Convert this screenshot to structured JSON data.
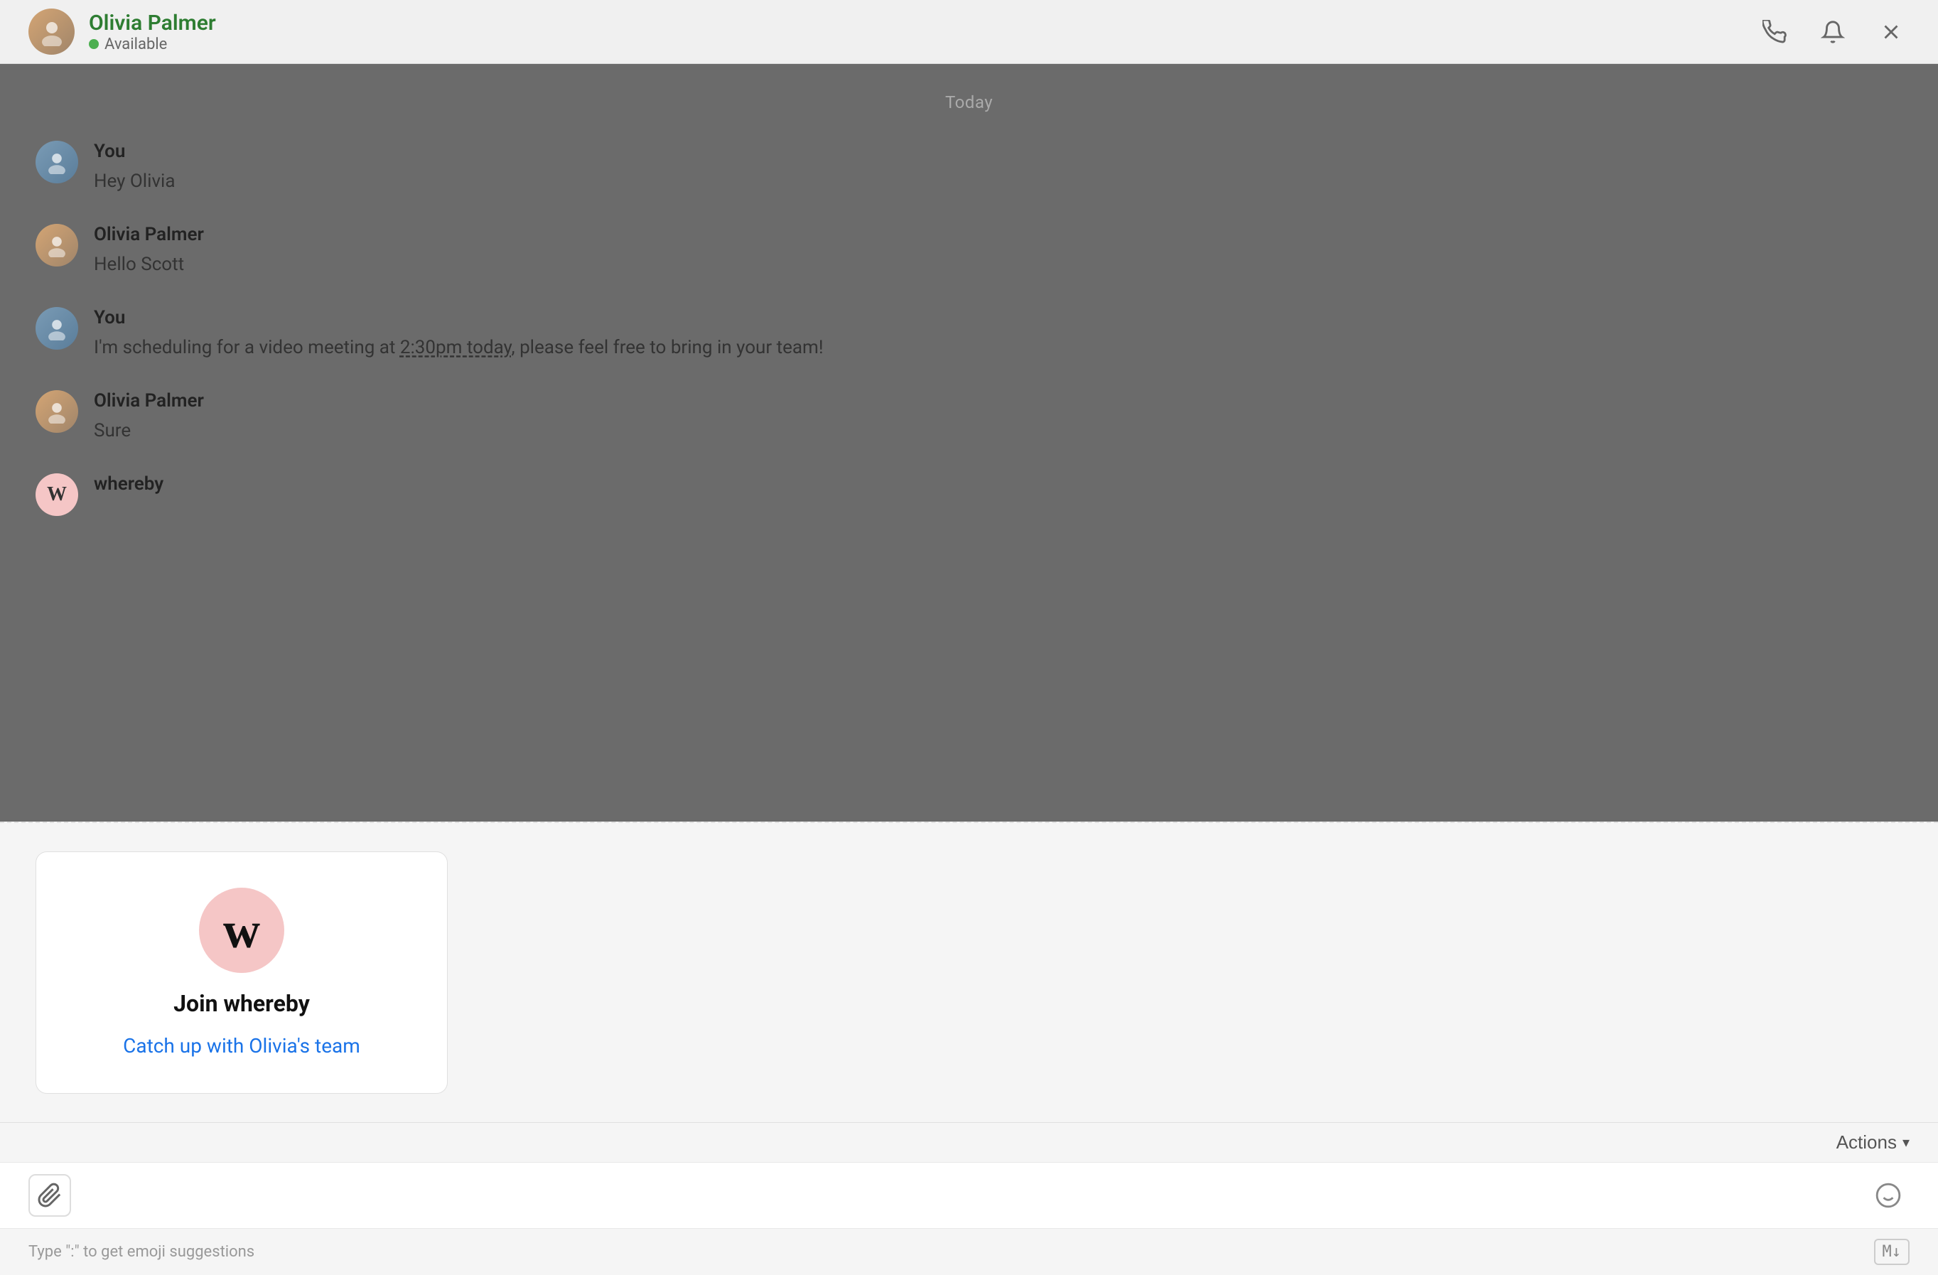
{
  "header": {
    "name": "Olivia Palmer",
    "status": "Available",
    "status_color": "#4caf50"
  },
  "date_divider": "Today",
  "messages": [
    {
      "sender": "You",
      "type": "you",
      "text": "Hey Olivia"
    },
    {
      "sender": "Olivia  Palmer",
      "type": "olivia",
      "text": "Hello Scott"
    },
    {
      "sender": "You",
      "type": "you",
      "text_parts": [
        {
          "text": "I'm scheduling for a video meeting at "
        },
        {
          "text": "2:30pm today",
          "underline": true
        },
        {
          "text": ", please feel free to bring in your team!"
        }
      ]
    },
    {
      "sender": "Olivia  Palmer",
      "type": "olivia",
      "text": "Sure"
    },
    {
      "sender": "whereby",
      "type": "whereby",
      "text": ""
    }
  ],
  "whereby_card": {
    "logo_letter": "w",
    "title": "Join whereby",
    "link_text": "Catch up with Olivia's team"
  },
  "actions_label": "Actions",
  "input": {
    "placeholder": ""
  },
  "footer": {
    "hint": "Type \":\" to get emoji suggestions",
    "markdown_label": "M↓"
  }
}
